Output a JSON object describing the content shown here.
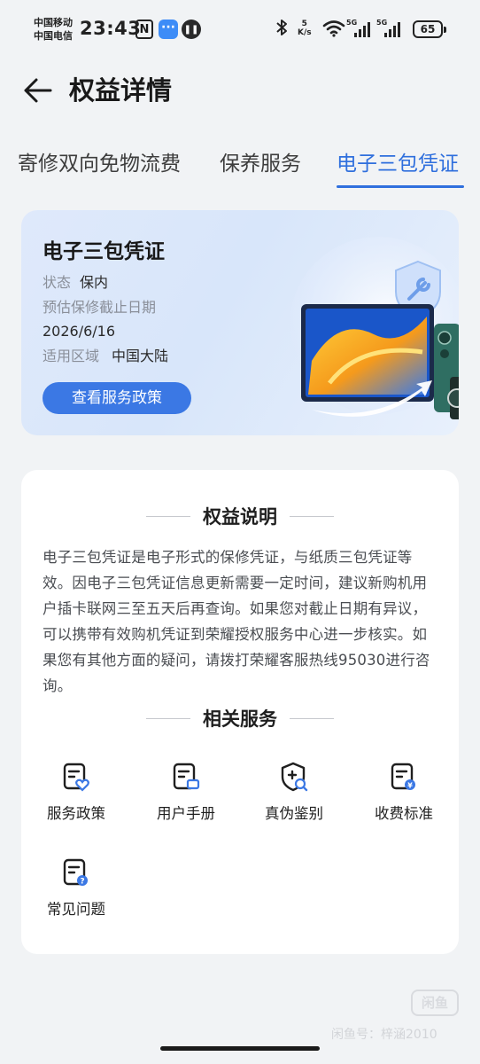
{
  "status_bar": {
    "carrier_1": "中国移动",
    "carrier_2": "中国电信",
    "time": "23:43",
    "nfc_label": "N",
    "net_speed_value": "5",
    "net_speed_unit": "K/s",
    "sim1_label": "5G",
    "sim2_label": "5G",
    "battery": "65",
    "icons": [
      "nfc-icon",
      "message-app-icon",
      "pause-icon",
      "bluetooth-icon",
      "wifi-icon",
      "signal-icon",
      "battery-icon"
    ]
  },
  "header": {
    "title": "权益详情",
    "back_icon": "back-arrow-icon"
  },
  "tabs": [
    {
      "label": "寄修双向免物流费",
      "active": false
    },
    {
      "label": "保养服务",
      "active": false
    },
    {
      "label": "电子三包凭证",
      "active": true
    }
  ],
  "warranty_card": {
    "title": "电子三包凭证",
    "status_label": "状态",
    "status_value": "保内",
    "expiry_label": "预估保修截止日期",
    "expiry_value": "2026/6/16",
    "region_label": "适用区域",
    "region_value": "中国大陆",
    "button_label": "查看服务政策",
    "accent_color": "#3b78e4"
  },
  "rights": {
    "heading": "权益说明",
    "description": "电子三包凭证是电子形式的保修凭证，与纸质三包凭证等效。因电子三包凭证信息更新需要一定时间，建议新购机用户插卡联网三至五天后再查询。如果您对截止日期有异议，可以携带有效购机凭证到荣耀授权服务中心进一步核实。如果您有其他方面的疑问，请拨打荣耀客服热线95030进行咨询。"
  },
  "related_services": {
    "heading": "相关服务",
    "items": [
      {
        "label": "服务政策",
        "icon": "policy-heart-icon"
      },
      {
        "label": "用户手册",
        "icon": "manual-icon"
      },
      {
        "label": "真伪鉴别",
        "icon": "authenticity-shield-icon"
      },
      {
        "label": "收费标准",
        "icon": "fee-standard-icon"
      },
      {
        "label": "常见问题",
        "icon": "faq-icon"
      }
    ]
  },
  "watermark": {
    "logo": "闲鱼",
    "text": "闲鱼号：梓涵2010"
  },
  "colors": {
    "accent": "#2f6fdd",
    "background": "#f1f3f5",
    "icon_blue": "#3b78e4"
  }
}
